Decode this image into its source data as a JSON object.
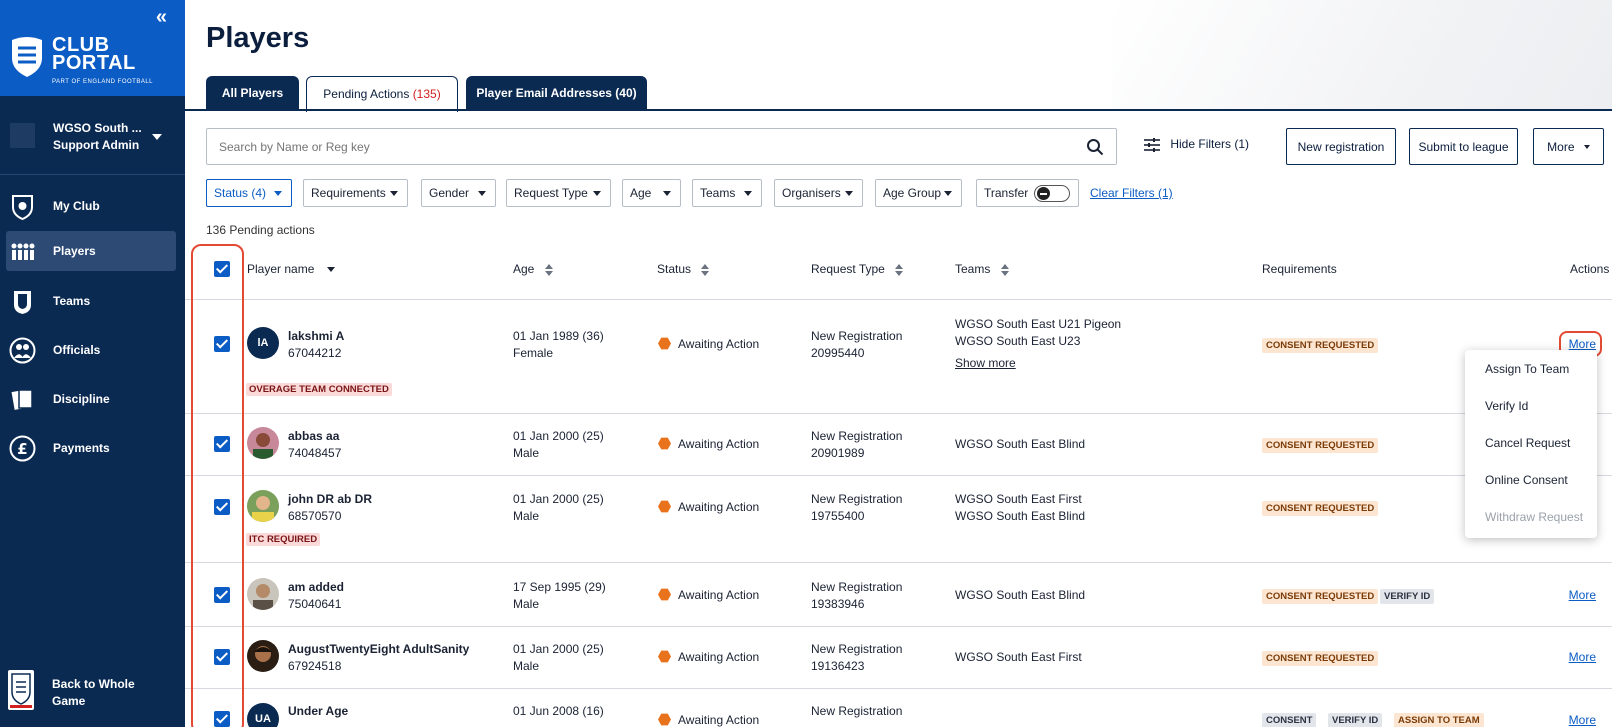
{
  "brand": {
    "title": "CLUB PORTAL",
    "subtitle": "PART OF ENGLAND FOOTBALL"
  },
  "org": {
    "name": "WGSO South ...",
    "role": "Support Admin"
  },
  "nav": [
    {
      "label": "My Club",
      "icon": "shield-icon"
    },
    {
      "label": "Players",
      "icon": "players-icon"
    },
    {
      "label": "Teams",
      "icon": "kit-icon"
    },
    {
      "label": "Officials",
      "icon": "officials-icon"
    },
    {
      "label": "Discipline",
      "icon": "cards-icon"
    },
    {
      "label": "Payments",
      "icon": "pound-icon"
    }
  ],
  "back_to_game": "Back to Whole Game",
  "page_title": "Players",
  "tabs": {
    "all_players": "All Players",
    "pending": "Pending Actions",
    "pending_count": "(135)",
    "emails": "Player Email Addresses (40)"
  },
  "search": {
    "placeholder": "Search by Name or Reg key"
  },
  "toolbar": {
    "hide_filters": "Hide Filters (1)",
    "new_registration": "New registration",
    "submit_to_league": "Submit to league",
    "more": "More"
  },
  "filters": {
    "status": "Status (4)",
    "requirements": "Requirements",
    "gender": "Gender",
    "request_type": "Request Type",
    "age": "Age",
    "teams": "Teams",
    "organisers": "Organisers",
    "age_group": "Age Group",
    "transfer": "Transfer",
    "clear": "Clear Filters (1)"
  },
  "pending_actions": "136 Pending actions",
  "columns": {
    "player_name": "Player name",
    "age": "Age",
    "status": "Status",
    "request_type": "Request Type",
    "teams": "Teams",
    "requirements": "Requirements",
    "actions": "Actions"
  },
  "rows": [
    {
      "initials": "lA",
      "name": "lakshmi A",
      "id": "67044212",
      "dob": "01 Jan 1989 (36)",
      "gender": "Female",
      "status": "Awaiting Action",
      "request": "New Registration",
      "request_id": "20995440",
      "team1": "WGSO South East U21 Pigeon",
      "team2": "WGSO South East U23",
      "show_more": "Show more",
      "req1": "CONSENT REQUESTED",
      "badge": "OVERAGE TEAM CONNECTED",
      "more": "More"
    },
    {
      "name": "abbas aa",
      "id": "74048457",
      "dob": "01 Jan 2000 (25)",
      "gender": "Male",
      "status": "Awaiting Action",
      "request": "New Registration",
      "request_id": "20901989",
      "team1": "WGSO South East Blind",
      "req1": "CONSENT REQUESTED"
    },
    {
      "name": "john DR ab DR",
      "id": "68570570",
      "dob": "01 Jan 2000 (25)",
      "gender": "Male",
      "status": "Awaiting Action",
      "request": "New Registration",
      "request_id": "19755400",
      "team1": "WGSO South East First",
      "team2": "WGSO South East Blind",
      "req1": "CONSENT REQUESTED",
      "badge": "ITC REQUIRED"
    },
    {
      "name": "am added",
      "id": "75040641",
      "dob": "17 Sep 1995 (29)",
      "gender": "Male",
      "status": "Awaiting Action",
      "request": "New Registration",
      "request_id": "19383946",
      "team1": "WGSO South East Blind",
      "req1": "CONSENT REQUESTED",
      "req2": "VERIFY ID",
      "more": "More"
    },
    {
      "name": "AugustTwentyEight AdultSanity",
      "id": "67924518",
      "dob": "01 Jan 2000 (25)",
      "gender": "Male",
      "status": "Awaiting Action",
      "request": "New Registration",
      "request_id": "19136423",
      "team1": "WGSO South East First",
      "req1": "CONSENT REQUESTED",
      "more": "More"
    },
    {
      "initials": "UA",
      "name": "Under Age",
      "dob": "01 Jun 2008 (16)",
      "status": "Awaiting Action",
      "request": "New Registration",
      "req1": "CONSENT",
      "req2": "VERIFY ID",
      "req3": "ASSIGN TO TEAM",
      "more": "More"
    }
  ],
  "dropdown": [
    "Assign To Team",
    "Verify Id",
    "Cancel Request",
    "Online Consent",
    "Withdraw Request"
  ],
  "colors": {
    "navy": "#0b2a52",
    "brand_blue": "#0b5cc4",
    "status_orange": "#e8731c",
    "highlight_red": "#e34a33"
  }
}
